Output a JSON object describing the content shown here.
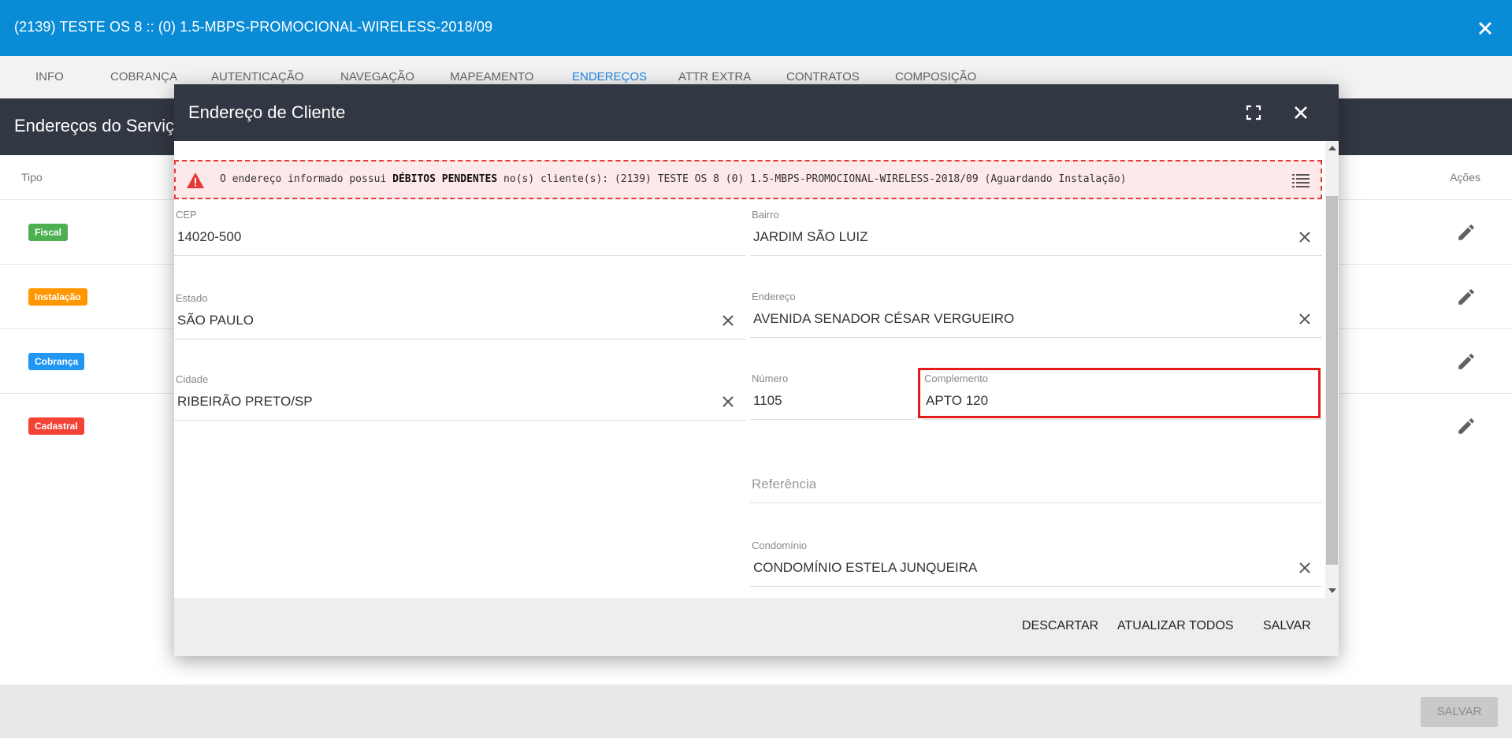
{
  "window": {
    "title": "(2139) TESTE OS 8 :: (0) 1.5-MBPS-PROMOCIONAL-WIRELESS-2018/09"
  },
  "tabs": [
    {
      "label": "INFO",
      "active": false
    },
    {
      "label": "COBRANÇA",
      "active": false
    },
    {
      "label": "AUTENTICAÇÃO",
      "active": false
    },
    {
      "label": "NAVEGAÇÃO",
      "active": false
    },
    {
      "label": "MAPEAMENTO",
      "active": false
    },
    {
      "label": "ENDEREÇOS",
      "active": true
    },
    {
      "label": "ATTR EXTRA",
      "active": false
    },
    {
      "label": "CONTRATOS",
      "active": false
    },
    {
      "label": "COMPOSIÇÃO",
      "active": false
    }
  ],
  "section": {
    "title": "Endereços do Serviç"
  },
  "list": {
    "col_tipo": "Tipo",
    "col_acoes": "Ações",
    "rows": [
      {
        "badge": "Fiscal",
        "color": "#4caf50"
      },
      {
        "badge": "Instalação",
        "color": "#ff9800"
      },
      {
        "badge": "Cobrança",
        "color": "#2196f3"
      },
      {
        "badge": "Cadastral",
        "color": "#f44336"
      }
    ]
  },
  "footer": {
    "save_label": "SALVAR"
  },
  "modal": {
    "title": "Endereço de Cliente",
    "alert": {
      "prefix": "O endereço informado possui ",
      "bold": "DÉBITOS PENDENTES",
      "suffix": " no(s) cliente(s): (2139) TESTE OS 8 (0) 1.5-MBPS-PROMOCIONAL-WIRELESS-2018/09 (Aguardando Instalação)"
    },
    "fields": {
      "cep": {
        "label": "CEP",
        "value": "14020-500"
      },
      "bairro": {
        "label": "Bairro",
        "value": "JARDIM SÃO LUIZ"
      },
      "estado": {
        "label": "Estado",
        "value": "SÃO PAULO"
      },
      "endereco": {
        "label": "Endereço",
        "value": "AVENIDA SENADOR CÉSAR VERGUEIRO"
      },
      "cidade": {
        "label": "Cidade",
        "value": "RIBEIRÃO PRETO/SP"
      },
      "numero": {
        "label": "Número",
        "value": "1105"
      },
      "complemento": {
        "label": "Complemento",
        "value": "APTO 120"
      },
      "referencia": {
        "placeholder": "Referência"
      },
      "condominio": {
        "label": "Condomínio",
        "value": "CONDOMÍNIO ESTELA JUNQUEIRA"
      }
    },
    "buttons": {
      "descartar": "DESCARTAR",
      "atualizar_todos": "ATUALIZAR TODOS",
      "salvar": "SALVAR"
    }
  }
}
